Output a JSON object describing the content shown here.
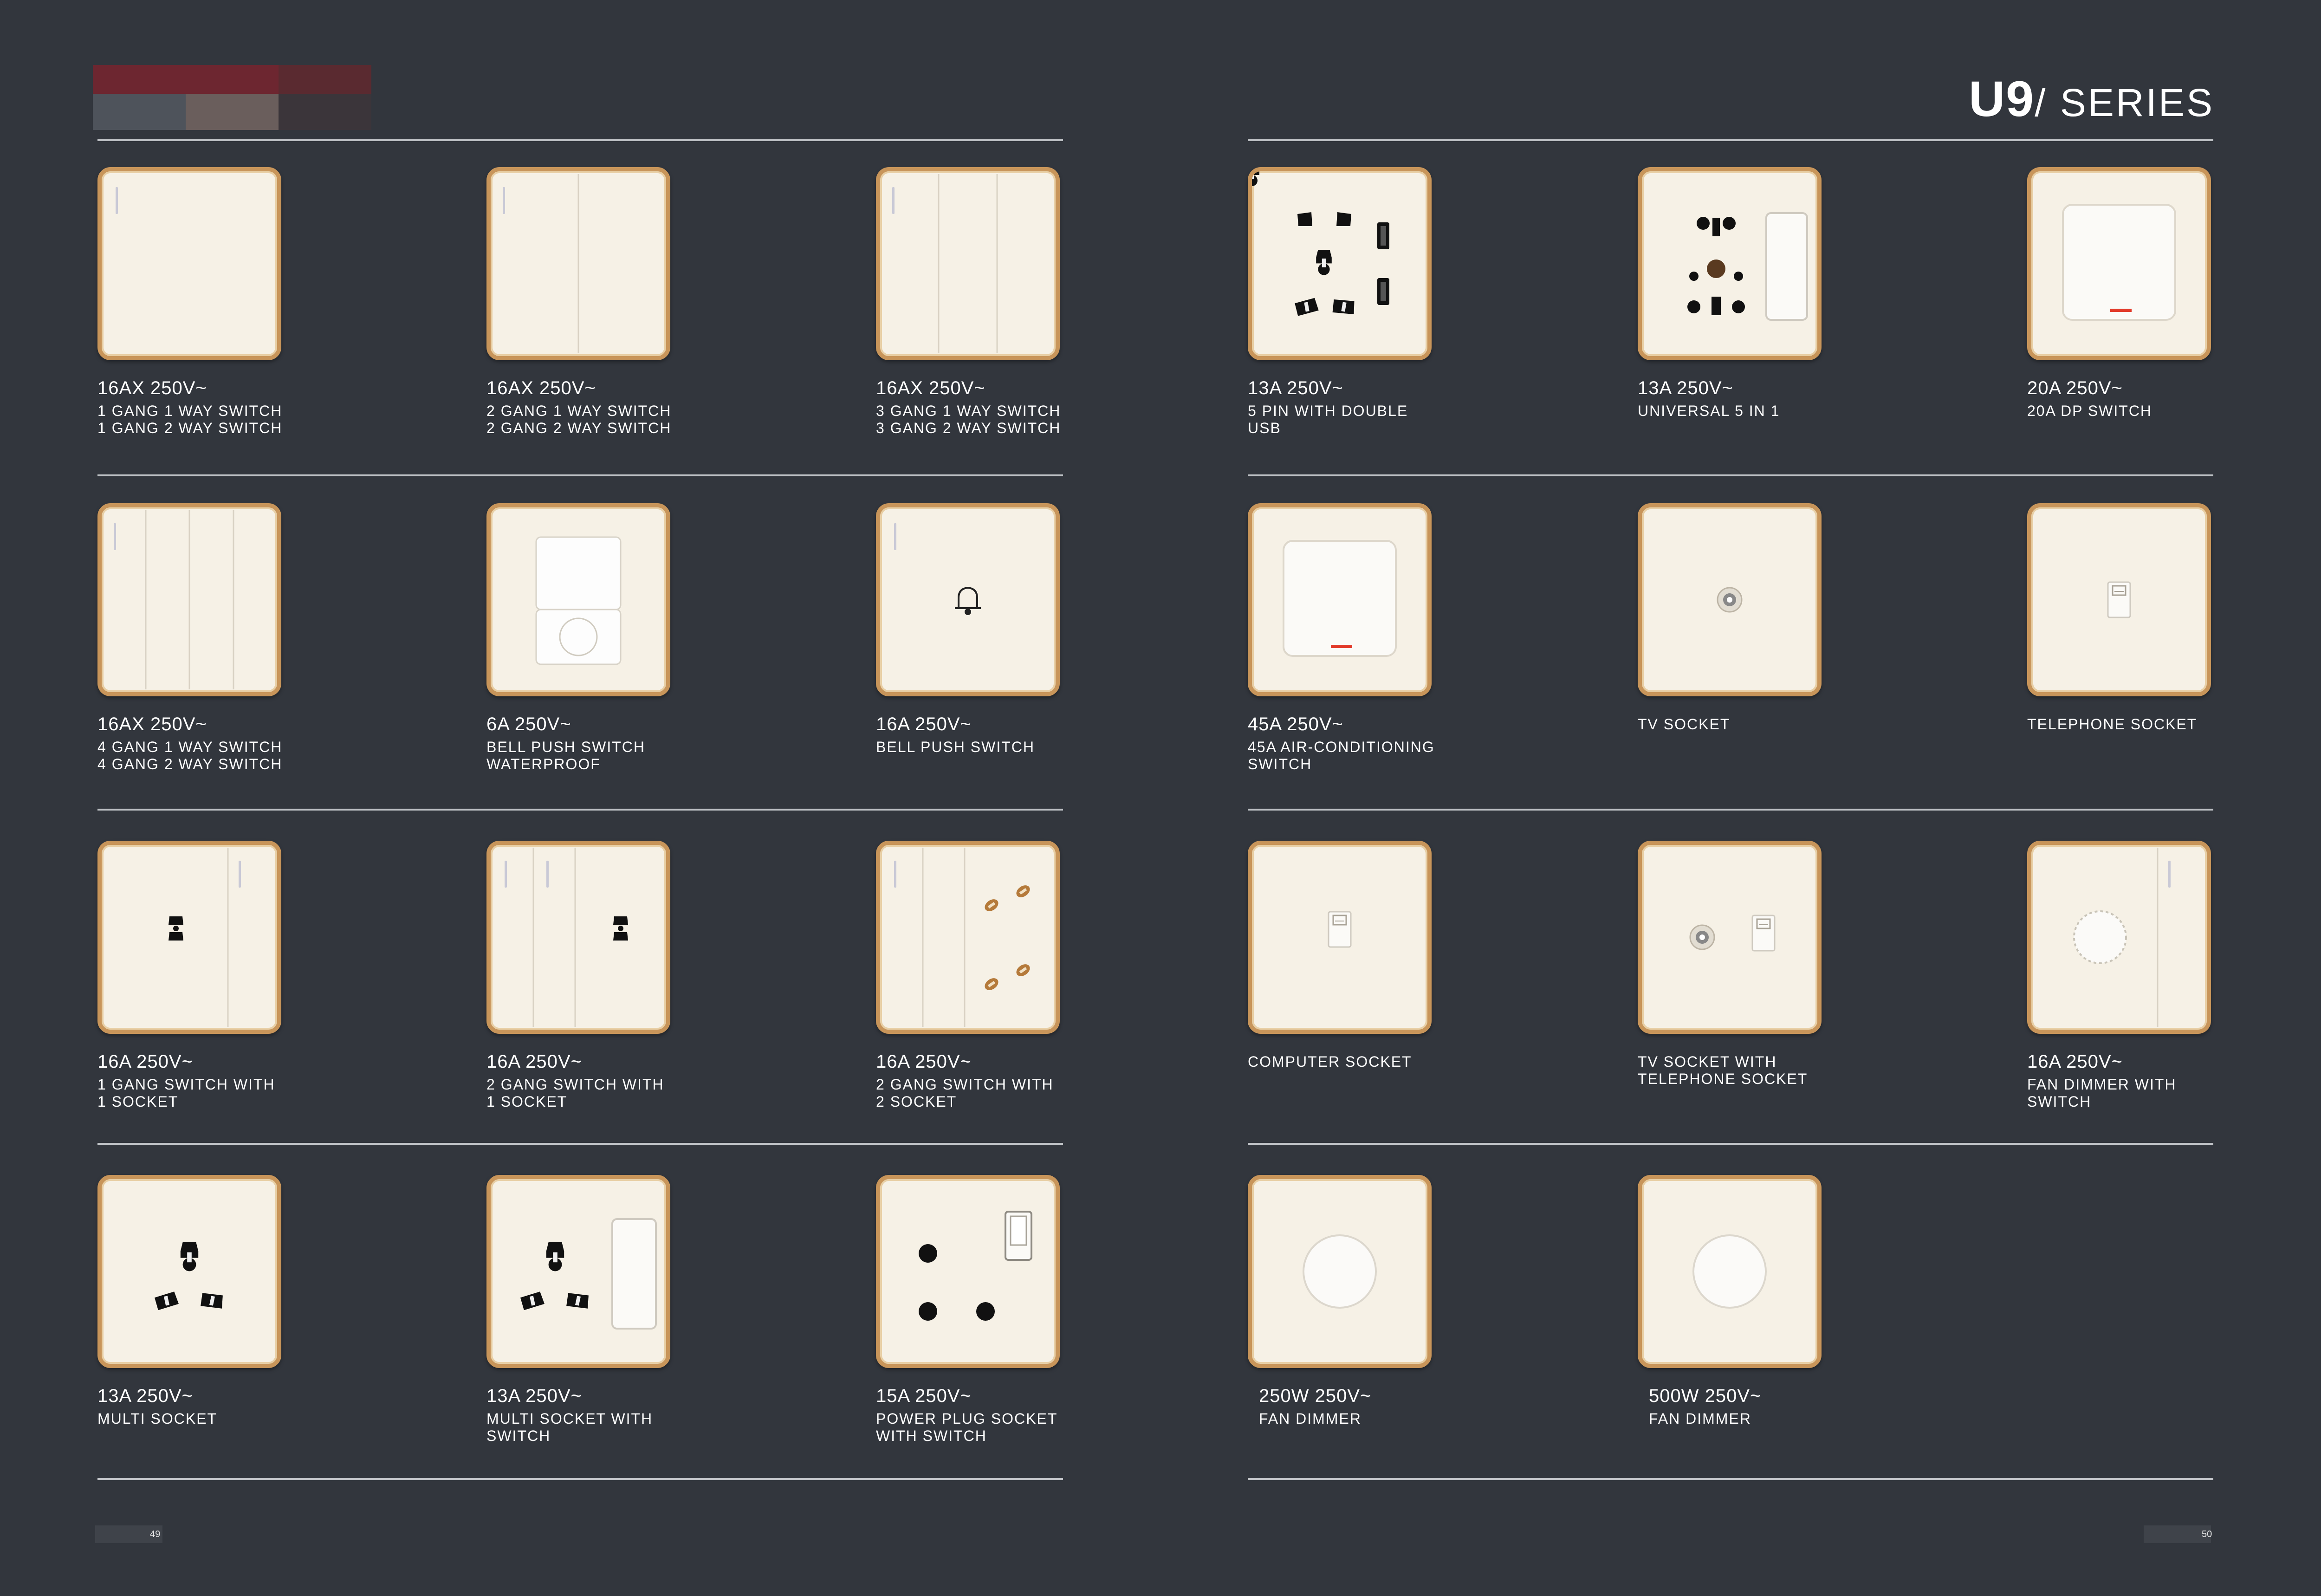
{
  "brand": {
    "series_main": "U9",
    "series_rest": "/ SERIES"
  },
  "items": [
    {
      "spec": "16AX 250V~",
      "d1": "1 GANG 1 WAY SWITCH",
      "d2": "1 GANG 2 WAY SWITCH"
    },
    {
      "spec": "16AX 250V~",
      "d1": "2 GANG 1 WAY SWITCH",
      "d2": "2 GANG 2 WAY SWITCH"
    },
    {
      "spec": "16AX 250V~",
      "d1": "3 GANG 1 WAY SWITCH",
      "d2": "3 GANG 2 WAY SWITCH"
    },
    {
      "spec": "13A 250V~",
      "d1": "5 PIN WITH DOUBLE",
      "d2": "USB"
    },
    {
      "spec": "13A 250V~",
      "d1": "UNIVERSAL 5 IN 1",
      "d2": ""
    },
    {
      "spec": "20A 250V~",
      "d1": "20A DP SWITCH",
      "d2": ""
    },
    {
      "spec": "16AX 250V~",
      "d1": "4 GANG 1 WAY SWITCH",
      "d2": "4 GANG 2 WAY SWITCH"
    },
    {
      "spec": "6A 250V~",
      "d1": "BELL PUSH SWITCH",
      "d2": "WATERPROOF"
    },
    {
      "spec": "16A 250V~",
      "d1": "BELL PUSH SWITCH",
      "d2": ""
    },
    {
      "spec": "45A 250V~",
      "d1": "45A AIR-CONDITIONING",
      "d2": "SWITCH"
    },
    {
      "spec": "",
      "d1": "TV SOCKET",
      "d2": ""
    },
    {
      "spec": "",
      "d1": "TELEPHONE SOCKET",
      "d2": ""
    },
    {
      "spec": "16A 250V~",
      "d1": "1 GANG SWITCH WITH",
      "d2": "1 SOCKET"
    },
    {
      "spec": "16A 250V~",
      "d1": "2 GANG SWITCH WITH",
      "d2": "1 SOCKET"
    },
    {
      "spec": "16A 250V~",
      "d1": "2 GANG SWITCH WITH",
      "d2": "2 SOCKET"
    },
    {
      "spec": "",
      "d1": "COMPUTER SOCKET",
      "d2": ""
    },
    {
      "spec": "",
      "d1": "TV SOCKET WITH",
      "d2": "TELEPHONE SOCKET"
    },
    {
      "spec": "16A 250V~",
      "d1": "FAN DIMMER WITH",
      "d2": "SWITCH"
    },
    {
      "spec": "13A 250V~",
      "d1": "MULTI SOCKET",
      "d2": ""
    },
    {
      "spec": "13A 250V~",
      "d1": "MULTI SOCKET WITH",
      "d2": "SWITCH"
    },
    {
      "spec": "15A 250V~",
      "d1": "POWER PLUG SOCKET",
      "d2": "WITH SWITCH"
    },
    {
      "spec": "250W 250V~",
      "d1": "FAN DIMMER",
      "d2": ""
    },
    {
      "spec": "500W 250V~",
      "d1": "FAN DIMMER",
      "d2": ""
    }
  ],
  "pages": {
    "left": "49",
    "right": "50"
  }
}
